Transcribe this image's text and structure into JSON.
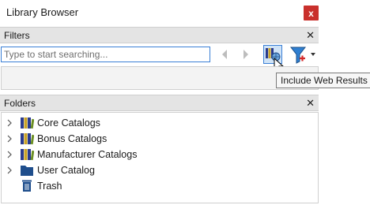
{
  "window": {
    "title": "Library Browser",
    "close_glyph": "x"
  },
  "filters": {
    "header": "Filters",
    "close_glyph": "✕",
    "search_placeholder": "Type to start searching...",
    "tooltip": "Include Web Results"
  },
  "folders": {
    "header": "Folders",
    "close_glyph": "✕",
    "items": [
      {
        "label": "Core Catalogs",
        "icon": "catalog-books-icon",
        "expandable": true
      },
      {
        "label": "Bonus Catalogs",
        "icon": "catalog-books-icon",
        "expandable": true
      },
      {
        "label": "Manufacturer Catalogs",
        "icon": "catalog-books-icon",
        "expandable": true
      },
      {
        "label": "User Catalog",
        "icon": "folder-icon",
        "expandable": true
      },
      {
        "label": "Trash",
        "icon": "trash-icon",
        "expandable": false
      }
    ]
  },
  "colors": {
    "accent": "#3a7fd5",
    "close": "#c9302c",
    "header_bg": "#e4e4e4"
  }
}
